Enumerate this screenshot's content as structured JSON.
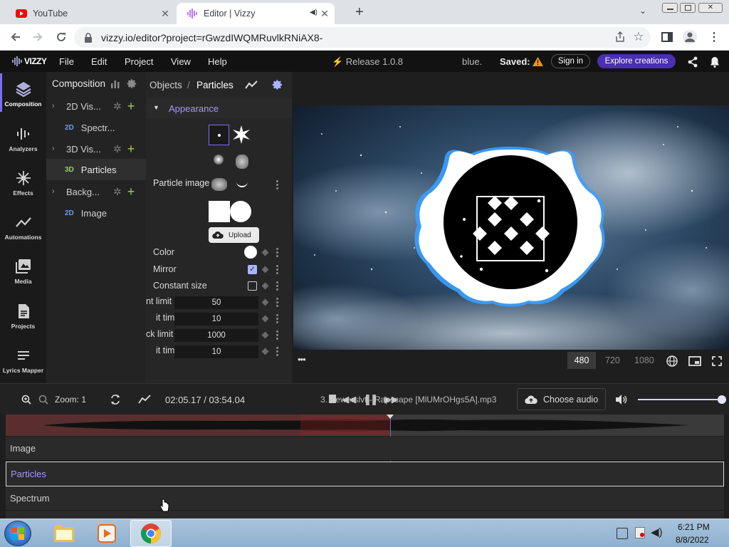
{
  "colors": {
    "accent": "#4a2fb0",
    "purple_text": "#a694ff",
    "youtube_red": "#ff0000",
    "warning": "#ff9500"
  },
  "browser": {
    "tabs": [
      {
        "label": "YouTube",
        "icon": "youtube-icon"
      },
      {
        "label": "Editor | Vizzy",
        "icon": "vizzy-icon"
      }
    ],
    "url": "vizzy.io/editor?project=rGwzdIWQMRuvlkRNiAX8-"
  },
  "app": {
    "logo": "VIZZY",
    "menu": [
      "File",
      "Edit",
      "Project",
      "View",
      "Help"
    ],
    "release": "⚡ Release 1.0.8",
    "project_name": "blue.",
    "saved_label": "Saved:",
    "sign_in": "Sign in",
    "explore": "Explore creations"
  },
  "rail": [
    "Composition",
    "Analyzers",
    "Effects",
    "Automations",
    "Media",
    "Projects",
    "Lyrics Mapper"
  ],
  "composition": {
    "title": "Composition",
    "items": [
      {
        "label": "2D Vis...",
        "kind": "group"
      },
      {
        "dim": "2D",
        "label": "Spectr...",
        "kind": "child"
      },
      {
        "label": "3D Vis...",
        "kind": "group"
      },
      {
        "dim": "3D",
        "label": "Particles",
        "kind": "child",
        "selected": true
      },
      {
        "label": "Backg...",
        "kind": "group"
      },
      {
        "dim": "2D",
        "label": "Image",
        "kind": "child"
      }
    ]
  },
  "props": {
    "breadcrumb_root": "Objects",
    "breadcrumb_sep": "/",
    "breadcrumb_current": "Particles",
    "section": "Appearance",
    "particle_image_label": "Particle image",
    "upload": "Upload",
    "rows": [
      {
        "label": "Color",
        "type": "color"
      },
      {
        "label": "Mirror",
        "type": "checkbox",
        "checked": true
      },
      {
        "label": "Constant size",
        "type": "checkbox",
        "checked": false
      },
      {
        "label": "nt limit",
        "type": "number",
        "value": "50"
      },
      {
        "label": "it time",
        "type": "number",
        "value": "10"
      },
      {
        "label": "ck limit",
        "type": "number",
        "value": "1000"
      },
      {
        "label": "it time",
        "type": "number",
        "value": "10"
      }
    ]
  },
  "preview": {
    "more": "•••",
    "resolutions": [
      "480",
      "720",
      "1080"
    ],
    "selected_resolution": "480"
  },
  "timeline": {
    "zoom": "Zoom: 1",
    "time": "02:05.17 / 03:54.04",
    "audio_file": "3. Sewerslvt - Rapscape [MlUMrOHgs5A].mp3",
    "choose_audio": "Choose audio",
    "volume": 1.0,
    "playhead_fraction": 0.535,
    "tracks": [
      "Image",
      "Particles",
      "Spectrum"
    ],
    "selected_track": "Particles"
  },
  "taskbar": {
    "time": "6:21 PM",
    "date": "8/8/2022"
  }
}
